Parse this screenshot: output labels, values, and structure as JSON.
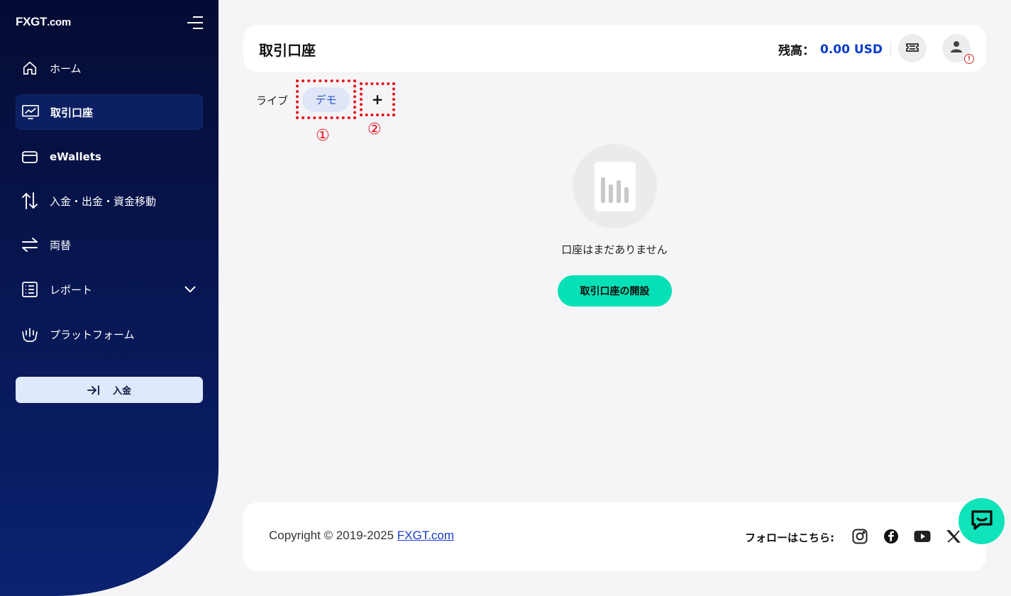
{
  "brand": {
    "logo_text": "FXGT",
    "logo_suffix": ".com"
  },
  "sidebar": {
    "items": [
      {
        "label": "ホーム",
        "icon": "home-icon"
      },
      {
        "label": "取引口座",
        "icon": "chart-monitor-icon",
        "active": true
      },
      {
        "label": "eWallets",
        "icon": "wallet-icon"
      },
      {
        "label": "入金・出金・資金移動",
        "icon": "transfer-arrows-icon"
      },
      {
        "label": "両替",
        "icon": "exchange-icon"
      },
      {
        "label": "レポート",
        "icon": "report-list-icon",
        "expandable": true
      },
      {
        "label": "プラットフォーム",
        "icon": "platform-icon"
      }
    ],
    "deposit_label": "入金"
  },
  "header": {
    "title": "取引口座",
    "balance_label": "残高：",
    "balance_value": "0.00 USD"
  },
  "tabs": {
    "live": "ライブ",
    "demo": "デモ",
    "add": "+"
  },
  "annotations": {
    "marker_1": "①",
    "marker_2": "②"
  },
  "empty_state": {
    "message": "口座はまだありません",
    "button": "取引口座の開設"
  },
  "footer": {
    "copyright": "Copyright © 2019-2025 ",
    "link": "FXGT.com",
    "follow": "フォローはこちら:",
    "social": [
      "instagram-icon",
      "facebook-icon",
      "youtube-icon",
      "x-icon"
    ]
  },
  "colors": {
    "accent": "#06e0b6",
    "balance_blue": "#0a3cc8",
    "annotation_red": "#e8111a",
    "sidebar_dark": "#050b33"
  }
}
